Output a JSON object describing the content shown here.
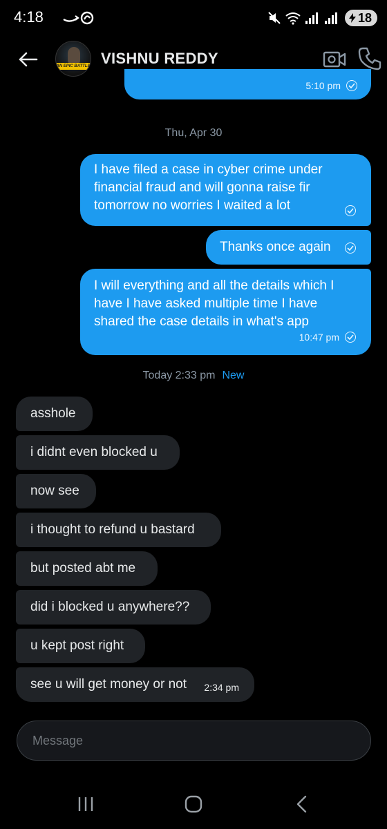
{
  "status": {
    "time": "4:18",
    "battery": "18"
  },
  "header": {
    "contact_name": "VISHNU REDDY",
    "avatar_caption": "AN EPIC BATTLE"
  },
  "messages": {
    "prev_time": "5:10 pm",
    "date_sep_1": "Thu, Apr 30",
    "out1": {
      "text": "I have filed a case in cyber crime under financial fraud and will gonna raise fir tomorrow no worries I waited a lot"
    },
    "out2": {
      "text": "Thanks once again"
    },
    "out3": {
      "text": "I will everything and all the details which I have I have asked multiple time I have shared the case details in what's app",
      "time": "10:47 pm"
    },
    "date_sep_2": "Today 2:33 pm",
    "new_label": "New",
    "incoming": [
      "asshole",
      "i didnt even blocked u",
      "now see",
      "i thought to refund u bastard",
      "but posted abt me",
      "did i blocked u anywhere??",
      "u kept post right",
      "see u will get money or not"
    ],
    "last_time": "2:34 pm"
  },
  "composer": {
    "placeholder": "Message"
  },
  "colors": {
    "outgoing_bubble": "#1d9bf0",
    "incoming_bubble": "#202327",
    "background": "#000000",
    "accent": "#1d9bf0"
  },
  "icons": [
    "back-arrow-icon",
    "video-call-icon",
    "phone-icon",
    "mute-icon",
    "wifi-icon",
    "signal-icon",
    "recents-icon",
    "home-icon",
    "nav-back-icon"
  ]
}
